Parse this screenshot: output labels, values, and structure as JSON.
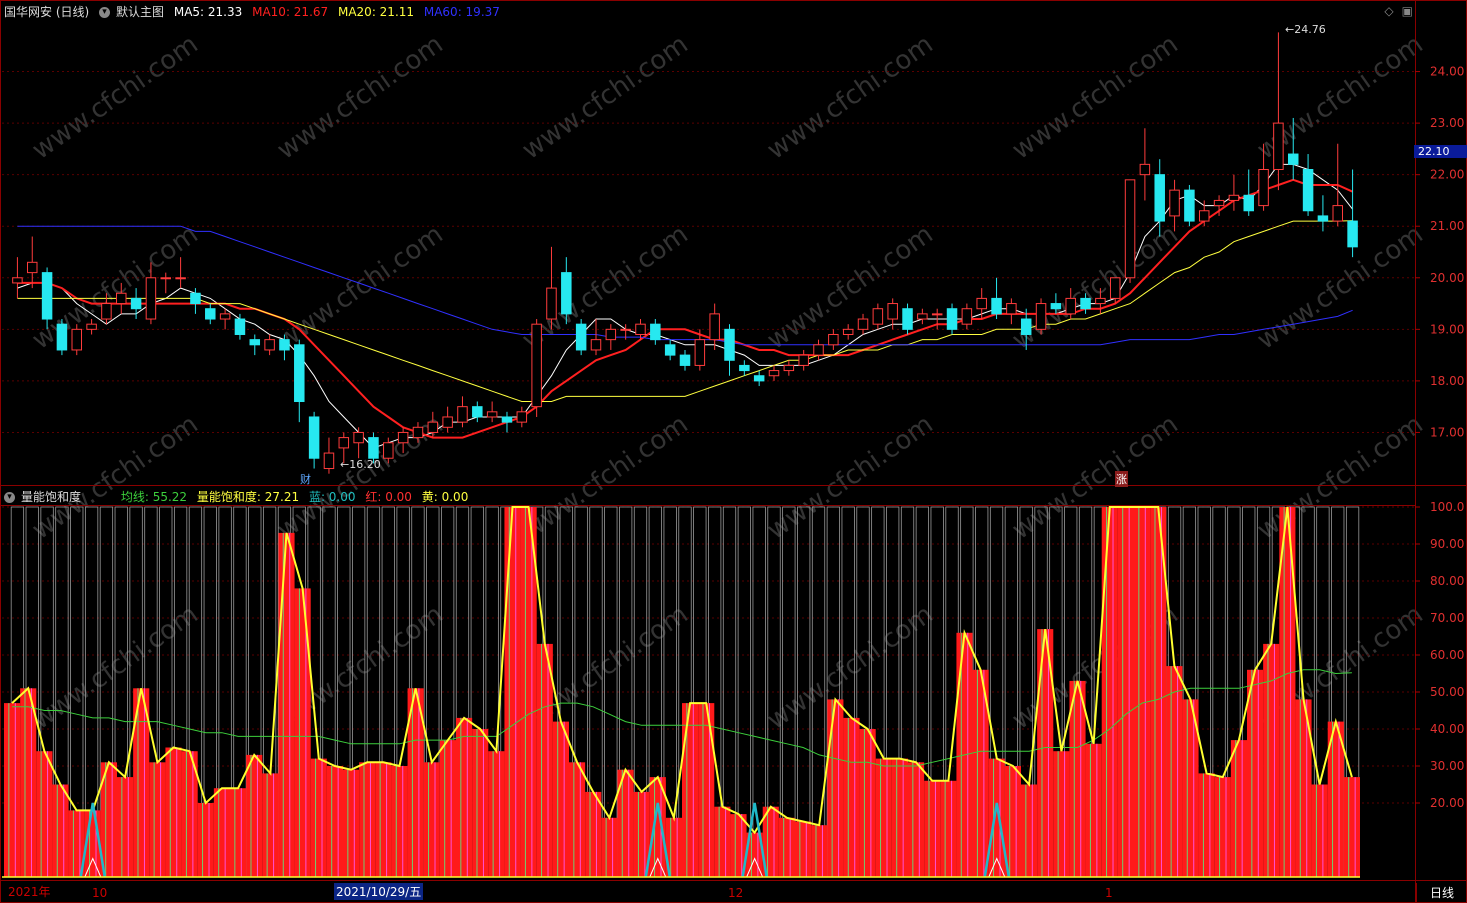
{
  "header": {
    "stock_name": "国华网安 (日线)",
    "main_chart_label": "默认主图",
    "ma5_label": "MA5: 21.33",
    "ma10_label": "MA10: 21.67",
    "ma20_label": "MA20: 21.11",
    "ma60_label": "MA60: 19.37",
    "colors": {
      "ma5": "#ffffff",
      "ma10": "#ff2020",
      "ma20": "#ffff40",
      "ma60": "#3030ff"
    }
  },
  "indicator_header": {
    "name": "量能饱和度",
    "avg_label": "均线: 55.22",
    "sat_label": "量能饱和度: 27.21",
    "blue_label": "蓝: 0.00",
    "red_label": "红: 0.00",
    "yellow_label": "黄: 0.00"
  },
  "annotations": {
    "high_label": "24.76",
    "low_label": "16.20",
    "current_price": "22.10",
    "cai_marker": "财",
    "zhang_marker": "涨"
  },
  "time_axis": {
    "year_label": "2021年",
    "oct_label": "10",
    "selected_date": "2021/10/29/五",
    "dec_label": "12",
    "jan_label": "1"
  },
  "period_tab": "日线",
  "icons": [
    "collapse-icon",
    "diamond-icon",
    "window-icon"
  ],
  "chart_data": [
    {
      "type": "candlestick",
      "title": "国华网安 (日线)",
      "ylim": [
        16.0,
        25.0
      ],
      "y_ticks": [
        "17.00",
        "18.00",
        "19.00",
        "20.00",
        "21.00",
        "22.00",
        "23.00",
        "24.00"
      ],
      "candles": [
        [
          19.9,
          20.0,
          19.6,
          20.4
        ],
        [
          20.1,
          20.3,
          19.8,
          20.8
        ],
        [
          20.1,
          19.2,
          19.0,
          20.2
        ],
        [
          19.1,
          18.6,
          18.5,
          19.2
        ],
        [
          18.6,
          19.0,
          18.5,
          19.1
        ],
        [
          19.0,
          19.1,
          18.9,
          19.2
        ],
        [
          19.2,
          19.5,
          19.1,
          19.7
        ],
        [
          19.5,
          19.7,
          19.3,
          19.9
        ],
        [
          19.6,
          19.4,
          19.2,
          19.8
        ],
        [
          19.2,
          20.0,
          19.1,
          20.3
        ],
        [
          20.0,
          20.0,
          19.7,
          20.1
        ],
        [
          20.0,
          20.0,
          19.8,
          20.4
        ],
        [
          19.7,
          19.5,
          19.3,
          19.8
        ],
        [
          19.4,
          19.2,
          19.1,
          19.5
        ],
        [
          19.2,
          19.3,
          19.0,
          19.4
        ],
        [
          19.2,
          18.9,
          18.8,
          19.3
        ],
        [
          18.8,
          18.7,
          18.5,
          18.9
        ],
        [
          18.6,
          18.8,
          18.5,
          18.9
        ],
        [
          18.8,
          18.6,
          18.4,
          18.9
        ],
        [
          18.7,
          17.6,
          17.2,
          18.8
        ],
        [
          17.3,
          16.5,
          16.3,
          17.4
        ],
        [
          16.3,
          16.6,
          16.2,
          16.9
        ],
        [
          16.7,
          16.9,
          16.4,
          17.0
        ],
        [
          16.8,
          17.0,
          16.5,
          17.1
        ],
        [
          16.9,
          16.5,
          16.4,
          17.0
        ],
        [
          16.5,
          16.8,
          16.4,
          16.9
        ],
        [
          16.8,
          17.0,
          16.6,
          17.1
        ],
        [
          16.9,
          17.1,
          16.8,
          17.2
        ],
        [
          17.0,
          17.2,
          16.9,
          17.4
        ],
        [
          17.1,
          17.3,
          17.0,
          17.5
        ],
        [
          17.2,
          17.5,
          17.1,
          17.7
        ],
        [
          17.5,
          17.3,
          17.2,
          17.6
        ],
        [
          17.3,
          17.4,
          17.2,
          17.6
        ],
        [
          17.3,
          17.2,
          17.0,
          17.4
        ],
        [
          17.2,
          17.4,
          17.1,
          17.5
        ],
        [
          17.5,
          19.1,
          17.3,
          19.2
        ],
        [
          19.2,
          19.8,
          19.0,
          20.6
        ],
        [
          20.1,
          19.3,
          19.1,
          20.4
        ],
        [
          19.1,
          18.6,
          18.5,
          19.2
        ],
        [
          18.6,
          18.8,
          18.5,
          19.2
        ],
        [
          18.8,
          19.0,
          18.6,
          19.1
        ],
        [
          19.0,
          19.0,
          18.8,
          19.1
        ],
        [
          18.9,
          19.1,
          18.8,
          19.2
        ],
        [
          19.1,
          18.8,
          18.7,
          19.2
        ],
        [
          18.7,
          18.5,
          18.4,
          18.8
        ],
        [
          18.5,
          18.3,
          18.2,
          18.6
        ],
        [
          18.3,
          18.8,
          18.2,
          19.0
        ],
        [
          18.8,
          19.3,
          18.6,
          19.5
        ],
        [
          19.0,
          18.4,
          18.1,
          19.1
        ],
        [
          18.3,
          18.2,
          18.1,
          18.4
        ],
        [
          18.1,
          18.0,
          17.9,
          18.2
        ],
        [
          18.1,
          18.2,
          18.0,
          18.3
        ],
        [
          18.2,
          18.3,
          18.1,
          18.4
        ],
        [
          18.3,
          18.5,
          18.2,
          18.6
        ],
        [
          18.5,
          18.7,
          18.4,
          18.8
        ],
        [
          18.7,
          18.9,
          18.6,
          19.0
        ],
        [
          18.9,
          19.0,
          18.8,
          19.1
        ],
        [
          19.0,
          19.2,
          18.9,
          19.3
        ],
        [
          19.1,
          19.4,
          19.0,
          19.5
        ],
        [
          19.2,
          19.5,
          19.0,
          19.6
        ],
        [
          19.4,
          19.0,
          18.9,
          19.5
        ],
        [
          19.2,
          19.3,
          19.1,
          19.4
        ],
        [
          19.3,
          19.3,
          19.0,
          19.4
        ],
        [
          19.4,
          19.0,
          18.9,
          19.5
        ],
        [
          19.1,
          19.4,
          19.0,
          19.5
        ],
        [
          19.4,
          19.6,
          19.2,
          19.8
        ],
        [
          19.6,
          19.3,
          19.2,
          20.0
        ],
        [
          19.3,
          19.5,
          19.1,
          19.6
        ],
        [
          19.2,
          18.9,
          18.6,
          19.4
        ],
        [
          19.0,
          19.5,
          18.9,
          19.6
        ],
        [
          19.5,
          19.4,
          19.3,
          19.7
        ],
        [
          19.3,
          19.6,
          19.2,
          19.8
        ],
        [
          19.6,
          19.4,
          19.3,
          19.7
        ],
        [
          19.5,
          19.6,
          19.3,
          19.8
        ],
        [
          19.6,
          20.0,
          19.5,
          20.0
        ],
        [
          20.0,
          21.9,
          19.9,
          21.9
        ],
        [
          22.0,
          22.2,
          21.5,
          22.9
        ],
        [
          22.0,
          21.1,
          20.8,
          22.3
        ],
        [
          21.2,
          21.7,
          20.9,
          21.9
        ],
        [
          21.7,
          21.1,
          21.0,
          21.8
        ],
        [
          21.1,
          21.3,
          21.0,
          21.5
        ],
        [
          21.4,
          21.5,
          21.2,
          21.6
        ],
        [
          21.5,
          21.6,
          21.3,
          22.0
        ],
        [
          21.6,
          21.3,
          21.2,
          22.1
        ],
        [
          21.4,
          22.1,
          21.3,
          22.6
        ],
        [
          22.1,
          23.0,
          21.7,
          24.76
        ],
        [
          22.4,
          22.2,
          21.9,
          23.1
        ],
        [
          22.1,
          21.3,
          21.2,
          22.4
        ],
        [
          21.2,
          21.1,
          20.9,
          21.6
        ],
        [
          21.1,
          21.4,
          21.0,
          22.6
        ],
        [
          21.1,
          20.6,
          20.4,
          22.1
        ]
      ],
      "ma_series": [
        {
          "name": "MA5",
          "color": "#ffffff",
          "values": [
            19.8,
            19.9,
            19.9,
            19.8,
            19.5,
            19.3,
            19.1,
            19.3,
            19.3,
            19.5,
            19.6,
            19.8,
            19.7,
            19.6,
            19.4,
            19.2,
            19.1,
            18.9,
            18.8,
            18.5,
            18.1,
            17.6,
            17.3,
            17.0,
            16.7,
            16.8,
            16.9,
            16.9,
            17.0,
            17.2,
            17.2,
            17.3,
            17.3,
            17.3,
            17.3,
            17.7,
            18.1,
            18.6,
            18.9,
            19.2,
            19.2,
            19.0,
            18.9,
            18.9,
            18.8,
            18.7,
            18.7,
            18.7,
            18.6,
            18.5,
            18.3,
            18.3,
            18.3,
            18.3,
            18.4,
            18.5,
            18.7,
            18.9,
            19.0,
            19.1,
            19.1,
            19.2,
            19.2,
            19.2,
            19.2,
            19.3,
            19.4,
            19.4,
            19.3,
            19.3,
            19.3,
            19.4,
            19.5,
            19.5,
            19.6,
            20.1,
            20.8,
            21.1,
            21.5,
            21.6,
            21.4,
            21.4,
            21.6,
            21.5,
            21.8,
            22.2,
            22.2,
            22.1,
            21.9,
            21.7,
            21.33
          ]
        },
        {
          "name": "MA10",
          "color": "#ff2020",
          "values": [
            19.9,
            19.9,
            19.9,
            19.8,
            19.6,
            19.5,
            19.5,
            19.5,
            19.5,
            19.5,
            19.5,
            19.5,
            19.5,
            19.5,
            19.5,
            19.4,
            19.4,
            19.3,
            19.2,
            19.0,
            18.7,
            18.4,
            18.1,
            17.8,
            17.5,
            17.3,
            17.1,
            17.0,
            16.9,
            16.9,
            16.9,
            17.0,
            17.1,
            17.2,
            17.3,
            17.5,
            17.8,
            18.0,
            18.2,
            18.4,
            18.5,
            18.6,
            18.8,
            19.0,
            19.0,
            19.0,
            18.9,
            18.8,
            18.8,
            18.7,
            18.6,
            18.6,
            18.5,
            18.5,
            18.5,
            18.5,
            18.5,
            18.6,
            18.7,
            18.8,
            18.9,
            19.0,
            19.1,
            19.1,
            19.2,
            19.2,
            19.3,
            19.3,
            19.3,
            19.3,
            19.3,
            19.3,
            19.4,
            19.4,
            19.5,
            19.7,
            20.0,
            20.3,
            20.6,
            20.9,
            21.1,
            21.3,
            21.5,
            21.6,
            21.7,
            21.8,
            21.9,
            21.8,
            21.8,
            21.8,
            21.67
          ]
        },
        {
          "name": "MA20",
          "color": "#ffff40",
          "values": [
            19.6,
            19.6,
            19.6,
            19.6,
            19.6,
            19.6,
            19.6,
            19.6,
            19.6,
            19.6,
            19.6,
            19.6,
            19.6,
            19.5,
            19.5,
            19.5,
            19.4,
            19.3,
            19.2,
            19.1,
            19.0,
            18.9,
            18.8,
            18.7,
            18.6,
            18.5,
            18.4,
            18.3,
            18.2,
            18.1,
            18.0,
            17.9,
            17.8,
            17.7,
            17.6,
            17.6,
            17.6,
            17.7,
            17.7,
            17.7,
            17.7,
            17.7,
            17.7,
            17.7,
            17.7,
            17.7,
            17.8,
            17.9,
            18.0,
            18.1,
            18.2,
            18.3,
            18.4,
            18.4,
            18.5,
            18.5,
            18.6,
            18.6,
            18.6,
            18.7,
            18.7,
            18.8,
            18.8,
            18.9,
            18.9,
            18.9,
            19.0,
            19.0,
            19.0,
            19.1,
            19.1,
            19.2,
            19.2,
            19.3,
            19.4,
            19.5,
            19.7,
            19.9,
            20.1,
            20.2,
            20.4,
            20.5,
            20.7,
            20.8,
            20.9,
            21.0,
            21.1,
            21.1,
            21.1,
            21.1,
            21.11
          ]
        },
        {
          "name": "MA60",
          "color": "#3030ff",
          "values": [
            21.0,
            21.0,
            21.0,
            21.0,
            21.0,
            21.0,
            21.0,
            21.0,
            21.0,
            21.0,
            21.0,
            21.0,
            20.9,
            20.9,
            20.8,
            20.7,
            20.6,
            20.5,
            20.4,
            20.3,
            20.2,
            20.1,
            20.0,
            19.9,
            19.8,
            19.7,
            19.6,
            19.5,
            19.4,
            19.3,
            19.2,
            19.1,
            19.0,
            18.95,
            18.9,
            18.9,
            18.9,
            18.9,
            18.9,
            18.9,
            18.85,
            18.85,
            18.85,
            18.8,
            18.8,
            18.8,
            18.8,
            18.8,
            18.75,
            18.7,
            18.7,
            18.7,
            18.7,
            18.7,
            18.7,
            18.7,
            18.7,
            18.7,
            18.7,
            18.7,
            18.7,
            18.7,
            18.7,
            18.7,
            18.7,
            18.7,
            18.7,
            18.7,
            18.7,
            18.7,
            18.7,
            18.7,
            18.7,
            18.7,
            18.75,
            18.8,
            18.8,
            18.8,
            18.8,
            18.8,
            18.85,
            18.9,
            18.9,
            18.95,
            19.0,
            19.05,
            19.1,
            19.15,
            19.2,
            19.25,
            19.37
          ]
        }
      ]
    },
    {
      "type": "bar",
      "title": "量能饱和度",
      "ylim": [
        0,
        100
      ],
      "y_ticks": [
        "20.00",
        "30.00",
        "40.00",
        "50.00",
        "60.00",
        "70.00",
        "80.00",
        "90.00",
        "100.0"
      ],
      "saturation": [
        47,
        51,
        34,
        25,
        18,
        18,
        31,
        27,
        51,
        31,
        35,
        34,
        20,
        24,
        24,
        33,
        28,
        93,
        78,
        32,
        30,
        29,
        31,
        31,
        30,
        51,
        31,
        37,
        43,
        40,
        34,
        100,
        100,
        63,
        42,
        31,
        23,
        16,
        29,
        23,
        27,
        16,
        47,
        47,
        19,
        17,
        12,
        19,
        16,
        15,
        14,
        48,
        43,
        40,
        32,
        32,
        31,
        26,
        26,
        66,
        56,
        32,
        30,
        25,
        67,
        34,
        53,
        36,
        100,
        100,
        100,
        100,
        57,
        48,
        28,
        27,
        37,
        56,
        63,
        100,
        48,
        25,
        42,
        27
      ],
      "average": [
        46,
        46,
        45,
        45,
        44,
        43,
        43,
        42,
        42,
        42,
        41,
        40,
        39,
        39,
        38,
        38,
        38,
        38,
        38,
        38,
        37,
        36,
        36,
        36,
        36,
        37,
        37,
        37,
        38,
        38,
        38,
        41,
        44,
        46,
        47,
        47,
        46,
        44,
        42,
        41,
        41,
        41,
        41,
        41,
        40,
        39,
        38,
        37,
        36,
        35,
        33,
        32,
        31,
        31,
        30,
        30,
        30,
        31,
        32,
        33,
        34,
        34,
        34,
        34,
        35,
        35,
        35,
        37,
        40,
        44,
        47,
        48,
        50,
        51,
        51,
        51,
        51,
        52,
        53,
        55,
        56,
        56,
        55,
        55.22
      ],
      "blue_peaks": [
        5,
        40,
        46,
        61
      ]
    }
  ]
}
